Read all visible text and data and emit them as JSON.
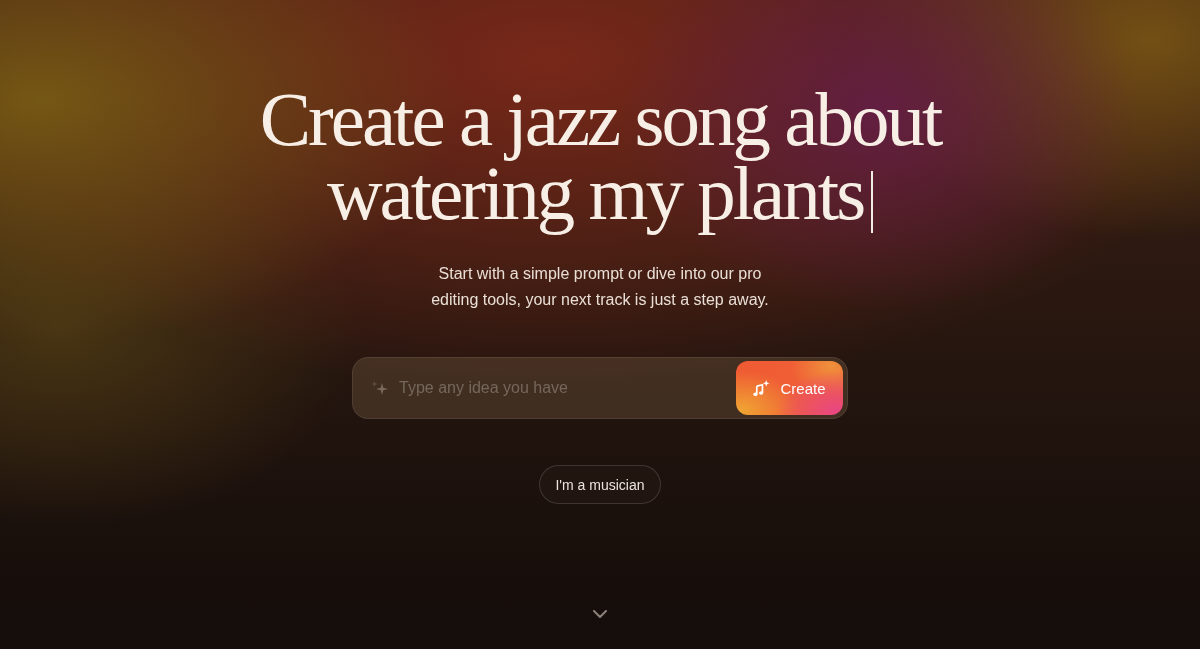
{
  "hero": {
    "headline_lines": [
      "Create a jazz song about",
      "watering my plants"
    ],
    "cursor_visible": true,
    "subtitle_lines": [
      "Start with a simple prompt or dive into our pro",
      "editing tools, your next track is just a step away."
    ]
  },
  "prompt": {
    "placeholder": "Type any idea you have",
    "button": "Create"
  },
  "secondary_button": "I'm a musician"
}
